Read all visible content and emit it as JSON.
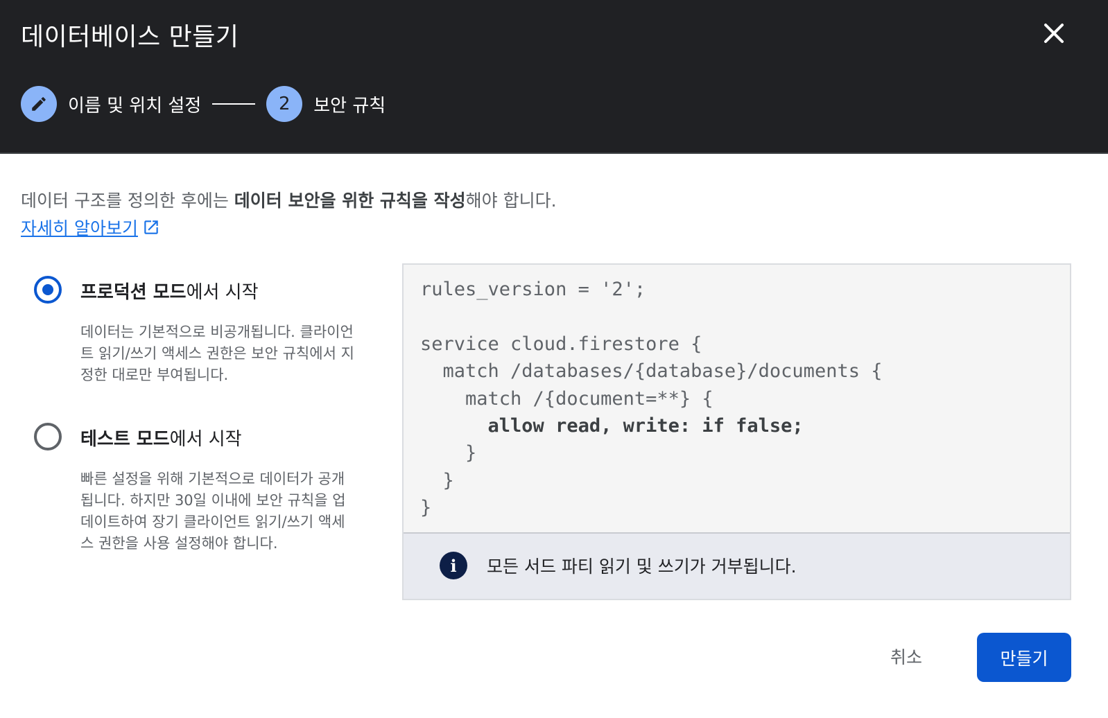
{
  "dialog": {
    "title": "데이터베이스 만들기",
    "close_icon": "close-icon"
  },
  "stepper": {
    "steps": [
      {
        "label": "이름 및 위치 설정",
        "icon": "pencil-icon",
        "state": "completed"
      },
      {
        "number": "2",
        "label": "보안 규칙",
        "state": "active"
      }
    ]
  },
  "intro": {
    "text_before": "데이터 구조를 정의한 후에는 ",
    "text_bold": "데이터 보안을 위한 규칙을 작성",
    "text_after": "해야 합니다.",
    "learn_more": "자세히 알아보기",
    "learn_more_icon": "open-in-new-icon"
  },
  "options": [
    {
      "title_bold": "프로덕션 모드",
      "title_rest": "에서 시작",
      "description": "데이터는 기본적으로 비공개됩니다. 클라이언트 읽기/쓰기 액세스 권한은 보안 규칙에서 지정한 대로만 부여됩니다.",
      "selected": true
    },
    {
      "title_bold": "테스트 모드",
      "title_rest": "에서 시작",
      "description": "빠른 설정을 위해 기본적으로 데이터가 공개됩니다. 하지만 30일 이내에 보안 규칙을 업데이트하여 장기 클라이언트 읽기/쓰기 액세스 권한을 사용 설정해야 합니다.",
      "selected": false
    }
  ],
  "rules": {
    "lines": [
      "rules_version = '2';",
      "",
      "service cloud.firestore {",
      "  match /databases/{database}/documents {",
      "    match /{document=**} {",
      "      allow read, write: if false;",
      "    }",
      "  }",
      "}"
    ],
    "bold_line_index": 5,
    "info_icon": "info-icon",
    "info_text": "모든 서드 파티 읽기 및 쓰기가 거부됩니다."
  },
  "actions": {
    "cancel": "취소",
    "create": "만들기"
  },
  "colors": {
    "header_bg": "#202124",
    "accent_blue": "#0b57d0",
    "step_circle": "#8ab4f8",
    "link": "#1a73e8"
  }
}
